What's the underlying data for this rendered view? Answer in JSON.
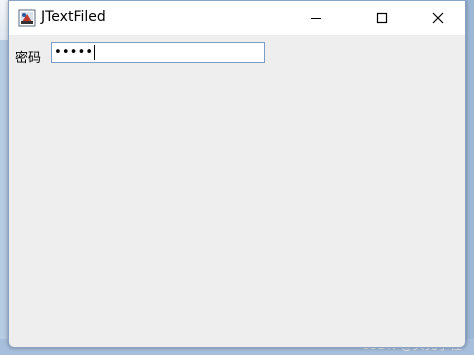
{
  "window": {
    "title": "JTextFiled",
    "controls": {
      "minimize_icon": "minimize-icon",
      "maximize_icon": "maximize-icon",
      "close_icon": "close-icon"
    }
  },
  "form": {
    "password_label": "密码",
    "password_value": "•••••"
  },
  "background": {
    "watermark": "CSDN @头秃小程"
  },
  "colors": {
    "window_bg": "#eeeeee",
    "titlebar_bg": "#ffffff",
    "field_border": "#7a9cc6"
  }
}
